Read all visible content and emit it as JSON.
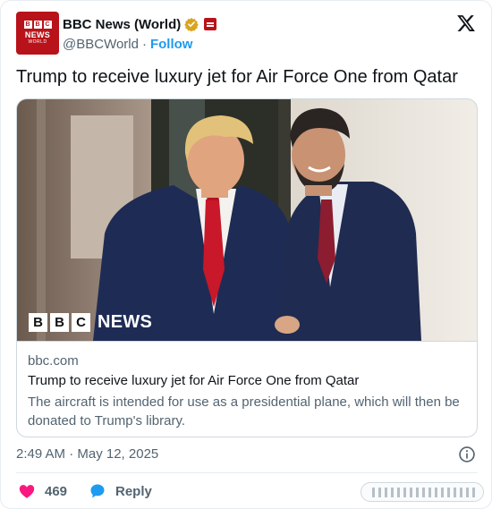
{
  "author": {
    "display_name": "BBC News (World)",
    "handle": "@BBCWorld",
    "follow_label": "Follow",
    "avatar_block_letters": [
      "B",
      "B",
      "C"
    ],
    "avatar_word": "NEWS",
    "avatar_subword": "WORLD",
    "verified": "gold-check",
    "affiliate_badge": "bbc-affiliate-badge"
  },
  "tweet": {
    "text": "Trump to receive luxury jet for Air Force One from Qatar"
  },
  "link_card": {
    "watermark_blocks": [
      "B",
      "B",
      "C"
    ],
    "watermark_word": "NEWS",
    "domain": "bbc.com",
    "title": "Trump to receive luxury jet for Air Force One from Qatar",
    "description": "The aircraft is intended for use as a presidential plane, which will then be donated to Trump's library."
  },
  "meta": {
    "timestamp": "2:49 AM · May 12, 2025"
  },
  "actions": {
    "like_count": "469",
    "reply_label": "Reply"
  },
  "colors": {
    "accent": "#1d9bf0",
    "like": "#f91880",
    "brand": "#b8131a",
    "muted": "#536471"
  }
}
